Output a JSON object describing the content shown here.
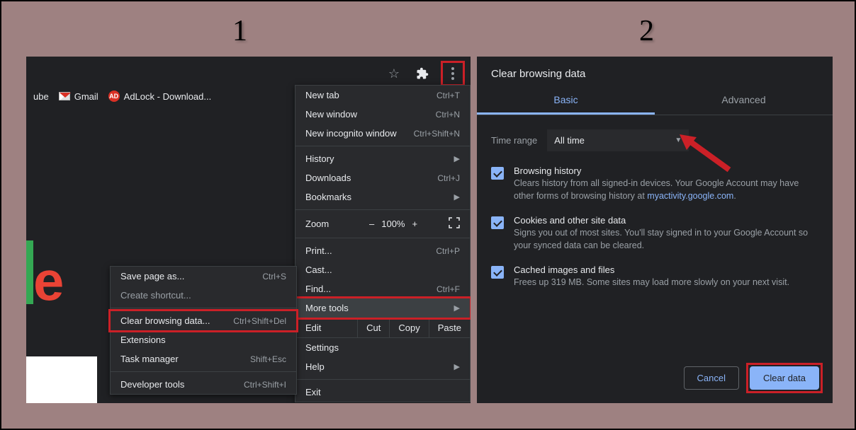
{
  "steps": {
    "one": "1",
    "two": "2"
  },
  "panel1": {
    "bookmarks": {
      "ube": "ube",
      "gmail": "Gmail",
      "adlock": "AdLock - Download..."
    },
    "menu": {
      "new_tab": "New tab",
      "new_tab_sc": "Ctrl+T",
      "new_window": "New window",
      "new_window_sc": "Ctrl+N",
      "incognito": "New incognito window",
      "incognito_sc": "Ctrl+Shift+N",
      "history": "History",
      "downloads": "Downloads",
      "downloads_sc": "Ctrl+J",
      "bookmarks": "Bookmarks",
      "zoom_lbl": "Zoom",
      "zoom_minus": "–",
      "zoom_pct": "100%",
      "zoom_plus": "+",
      "print": "Print...",
      "print_sc": "Ctrl+P",
      "cast": "Cast...",
      "find": "Find...",
      "find_sc": "Ctrl+F",
      "more_tools": "More tools",
      "edit_lbl": "Edit",
      "edit_cut": "Cut",
      "edit_copy": "Copy",
      "edit_paste": "Paste",
      "settings": "Settings",
      "help": "Help",
      "exit": "Exit"
    },
    "submenu": {
      "save_page": "Save page as...",
      "save_page_sc": "Ctrl+S",
      "create_shortcut": "Create shortcut...",
      "clear_data": "Clear browsing data...",
      "clear_data_sc": "Ctrl+Shift+Del",
      "extensions": "Extensions",
      "task_manager": "Task manager",
      "task_manager_sc": "Shift+Esc",
      "dev_tools": "Developer tools",
      "dev_tools_sc": "Ctrl+Shift+I"
    }
  },
  "panel2": {
    "title": "Clear browsing data",
    "tabs": {
      "basic": "Basic",
      "advanced": "Advanced"
    },
    "time_range_lbl": "Time range",
    "time_range_val": "All time",
    "items": {
      "bh_h": "Browsing history",
      "bh_d1": "Clears history from all signed-in devices. Your Google Account may have other forms of browsing history at ",
      "bh_link": "myactivity.google.com",
      "bh_d2": ".",
      "ck_h": "Cookies and other site data",
      "ck_d": "Signs you out of most sites. You'll stay signed in to your Google Account so your synced data can be cleared.",
      "cf_h": "Cached images and files",
      "cf_d": "Frees up 319 MB. Some sites may load more slowly on your next visit."
    },
    "cancel": "Cancel",
    "clear": "Clear data"
  }
}
